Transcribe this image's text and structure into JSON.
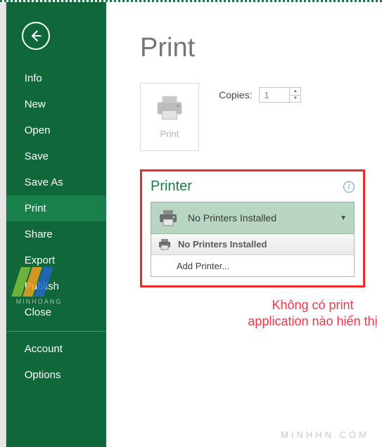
{
  "sidebar": {
    "items": [
      {
        "label": "Info"
      },
      {
        "label": "New"
      },
      {
        "label": "Open"
      },
      {
        "label": "Save"
      },
      {
        "label": "Save As"
      },
      {
        "label": "Print"
      },
      {
        "label": "Share"
      },
      {
        "label": "Export"
      },
      {
        "label": "Publish"
      },
      {
        "label": "Close"
      }
    ],
    "footer": [
      {
        "label": "Account"
      },
      {
        "label": "Options"
      }
    ],
    "watermark_text": "MINHOANG"
  },
  "main": {
    "title": "Print",
    "print_button": "Print",
    "copies_label": "Copies:",
    "copies_value": "1",
    "printer_section_title": "Printer",
    "selected_printer": "No Printers Installed",
    "dropdown": {
      "header": "No Printers Installed",
      "add": "Add Printer..."
    }
  },
  "callout": "Không có print application nào hiển thị",
  "brand": "MINHHN.COM"
}
